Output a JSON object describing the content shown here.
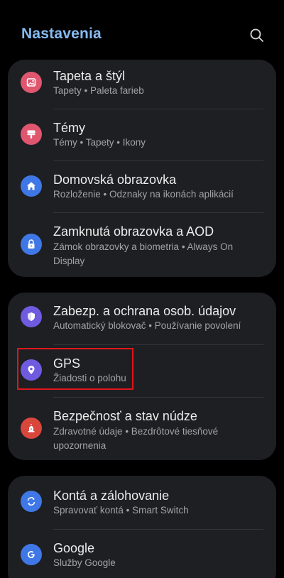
{
  "header": {
    "title": "Nastavenia",
    "search_icon": "search-icon"
  },
  "groups": [
    {
      "items": [
        {
          "label": "Tapeta a štýl",
          "sub": "Tapety  •  Paleta farieb",
          "icon": "wallpaper-icon",
          "color": "#E0566F"
        },
        {
          "label": "Témy",
          "sub": "Témy  •  Tapety  •  Ikony",
          "icon": "themes-icon",
          "color": "#E0566F"
        },
        {
          "label": "Domovská obrazovka",
          "sub": "Rozloženie  •  Odznaky na ikonách aplikácií",
          "icon": "home-icon",
          "color": "#3F78E6"
        },
        {
          "label": "Zamknutá obrazovka a AOD",
          "sub": "Zámok obrazovky a biometria  •  Always On Display",
          "icon": "lock-icon",
          "color": "#3F78E6"
        }
      ]
    },
    {
      "items": [
        {
          "label": "Zabezp. a ochrana osob. údajov",
          "sub": "Automatický blokovač  •  Používanie povolení",
          "icon": "shield-icon",
          "color": "#6E5BE0"
        },
        {
          "label": "GPS",
          "sub": "Žiadosti o polohu",
          "icon": "location-pin-icon",
          "color": "#6E5BE0"
        },
        {
          "label": "Bezpečnosť a stav núdze",
          "sub": "Zdravotné údaje  •  Bezdrôtové tiesňové upozornenia",
          "icon": "emergency-icon",
          "color": "#D8463C"
        }
      ]
    },
    {
      "items": [
        {
          "label": "Kontá a zálohovanie",
          "sub": "Spravovať kontá  •  Smart Switch",
          "icon": "sync-icon",
          "color": "#3F78E6"
        },
        {
          "label": "Google",
          "sub": "Služby Google",
          "icon": "google-icon",
          "color": "#3F78E6"
        }
      ]
    }
  ],
  "highlight_color": "#E0161A"
}
